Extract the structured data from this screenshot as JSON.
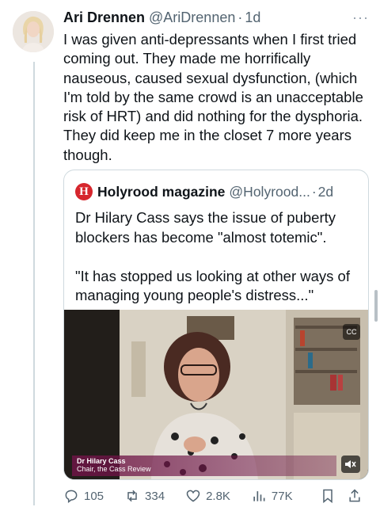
{
  "tweet": {
    "author_name": "Ari Drennen",
    "author_handle": "@AriDrennen",
    "separator": "·",
    "time": "1d",
    "more_icon": "more-horizontal-icon",
    "text": "I was given anti-depressants when I first tried coming out. They made me horrifically nauseous, caused sexual dysfunction, (which I'm told by the same crowd is an unacceptable risk of HRT) and did nothing for the dysphoria. They did keep me in the closet 7 more years though."
  },
  "quote": {
    "logo_letter": "H",
    "logo_color": "#d6262d",
    "author_name": "Holyrood magazine",
    "author_handle": "@Holyrood...",
    "separator": "·",
    "time": "2d",
    "text": "Dr Hilary Cass says the issue of puberty blockers has become \"almost totemic\".\n\n\"It has stopped us looking at other ways of managing young people's distress...\"",
    "video": {
      "caption_name": "Dr Hilary Cass",
      "caption_title": "Chair, the Cass Review",
      "mute_icon": "speaker-muted-icon",
      "cc_icon": "captions-icon"
    }
  },
  "actions": {
    "replies": "105",
    "reposts": "334",
    "likes": "2.8K",
    "views": "77K"
  },
  "colors": {
    "text": "#0f1419",
    "secondary": "#536471",
    "border": "#cfd9de"
  }
}
